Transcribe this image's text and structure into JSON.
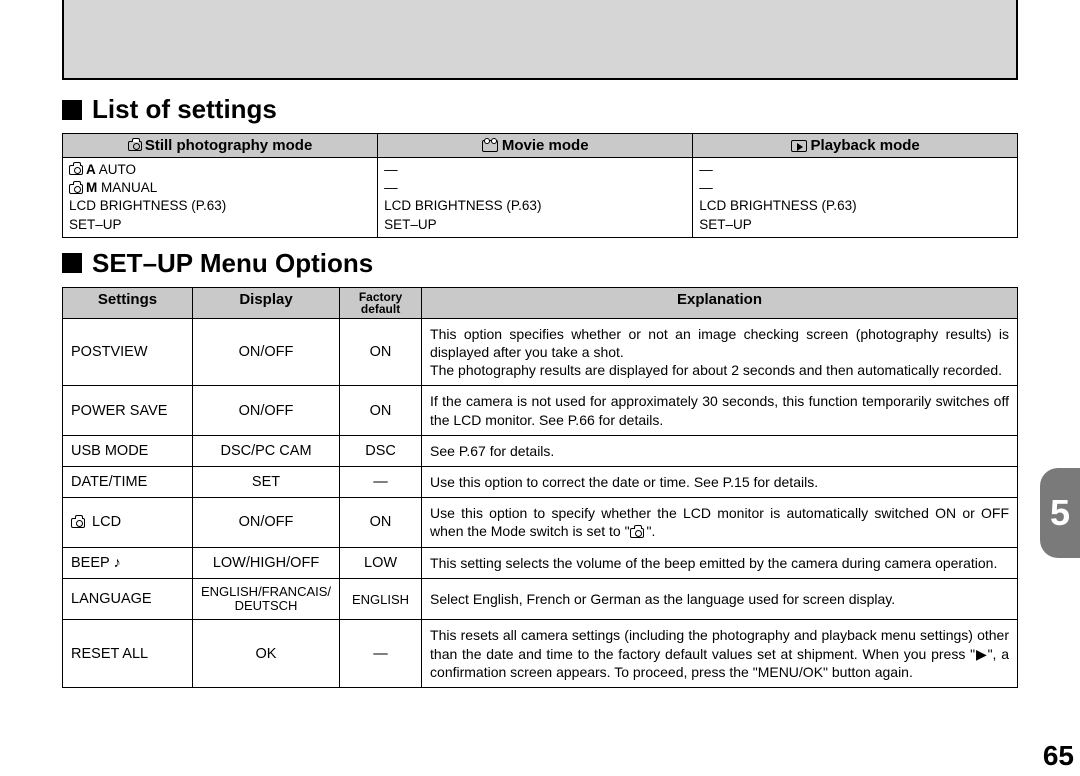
{
  "page_number": "65",
  "tab_number": "5",
  "sections": {
    "list_title": "List of settings",
    "setup_title": "SET–UP Menu Options"
  },
  "modes_table": {
    "headers": {
      "still": "Still photography mode",
      "movie": "Movie mode",
      "playback": "Playback mode"
    },
    "still_rows": [
      "A AUTO",
      "M MANUAL",
      "LCD BRIGHTNESS (P.63)",
      "SET–UP"
    ],
    "movie_rows": [
      "—",
      "—",
      "LCD BRIGHTNESS (P.63)",
      "SET–UP"
    ],
    "playback_rows": [
      "—",
      "—",
      "LCD BRIGHTNESS (P.63)",
      "SET–UP"
    ]
  },
  "setup_table": {
    "headers": {
      "settings": "Settings",
      "display": "Display",
      "default": "Factory default",
      "explanation": "Explanation"
    },
    "rows": [
      {
        "setting": "POSTVIEW",
        "display": "ON/OFF",
        "default": "ON",
        "explanation": "This option specifies whether or not an image checking screen (photography results) is displayed after you take a shot.\nThe photography results are displayed for about 2 seconds and then automatically recorded."
      },
      {
        "setting": "POWER SAVE",
        "display": "ON/OFF",
        "default": "ON",
        "explanation": "If the camera is not used for approximately 30 seconds, this function temporarily switches off the LCD monitor. See P.66 for details."
      },
      {
        "setting": "USB MODE",
        "display": "DSC/PC CAM",
        "default": "DSC",
        "explanation": "See P.67 for details."
      },
      {
        "setting": "DATE/TIME",
        "display": "SET",
        "default": "—",
        "explanation": "Use this option to correct the date or time. See P.15 for details."
      },
      {
        "setting": "LCD",
        "icon": "camera",
        "display": "ON/OFF",
        "default": "ON",
        "explanation": "Use this option to specify whether the LCD monitor is automatically switched ON or OFF when the Mode switch is set to \"camera\"."
      },
      {
        "setting": "BEEP",
        "icon_after": "note",
        "display": "LOW/HIGH/OFF",
        "default": "LOW",
        "explanation": "This setting selects the volume of the beep emitted by the camera during camera operation."
      },
      {
        "setting": "LANGUAGE",
        "display": "ENGLISH/FRANCAIS/\nDEUTSCH",
        "default": "ENGLISH",
        "explanation": "Select English, French or German as the language used for screen display."
      },
      {
        "setting": "RESET ALL",
        "display": "OK",
        "default": "—",
        "explanation": "This resets all camera settings (including the photography and playback menu settings) other than the date and time to the factory default values set at shipment. When you press \"▶\", a confirmation screen appears. To proceed, press the \"MENU/OK\" button again."
      }
    ]
  }
}
